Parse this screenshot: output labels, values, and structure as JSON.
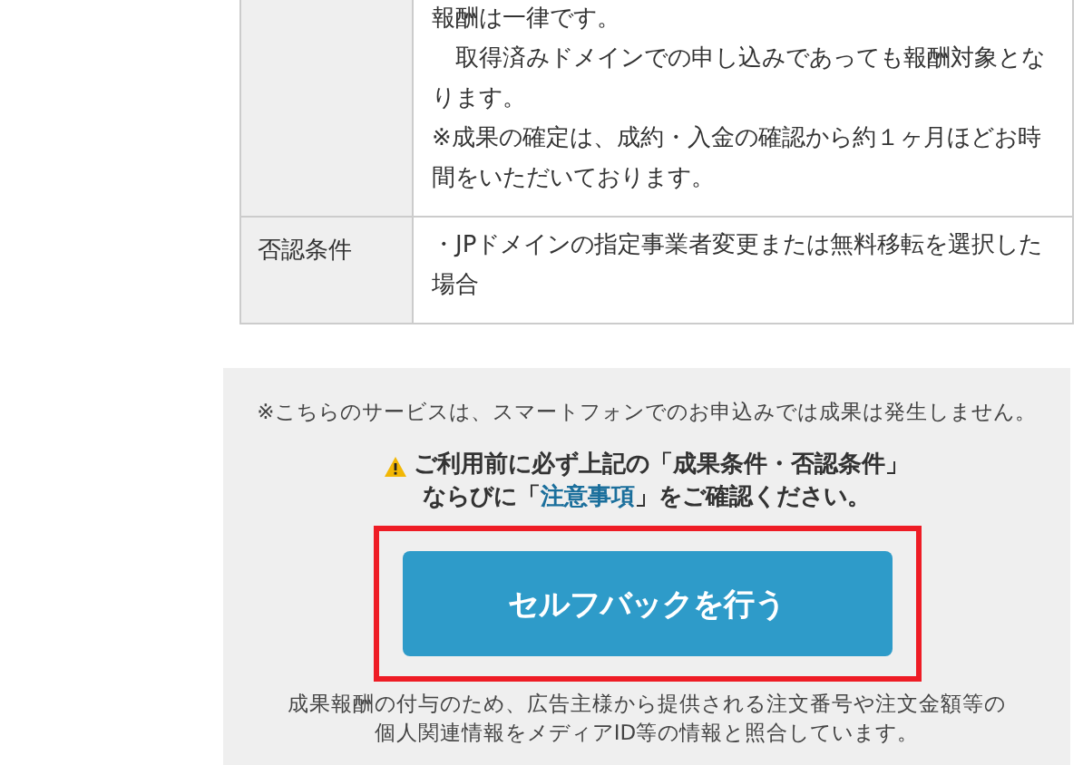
{
  "table": {
    "rows": [
      {
        "label": "",
        "paragraphs": [
          "報酬は一律です。",
          "　取得済みドメインでの申し込みであっても報酬対象となります。",
          "※成果の確定は、成約・入金の確認から約１ヶ月ほどお時間をいただいております。"
        ]
      },
      {
        "label": "否認条件",
        "paragraphs": [
          "・JPドメインの指定事業者変更または無料移転を選択した場合"
        ]
      }
    ]
  },
  "panel": {
    "smartphone_note": "※こちらのサービスは、スマートフォンでのお申込みでは成果は発生しません。",
    "warning": {
      "line_1": "ご利用前に必ず上記の「成果条件・否認条件」",
      "before": "ならびに「",
      "link": "注意事項",
      "after": "」をご確認ください。"
    },
    "button": {
      "label": "セルフバックを行う",
      "highlighted": true
    },
    "privacy_note": [
      "成果報酬の付与のため、広告主様から提供される注文番号や注文金額等の",
      "個人関連情報をメディアID等の情報と照合しています。"
    ]
  }
}
